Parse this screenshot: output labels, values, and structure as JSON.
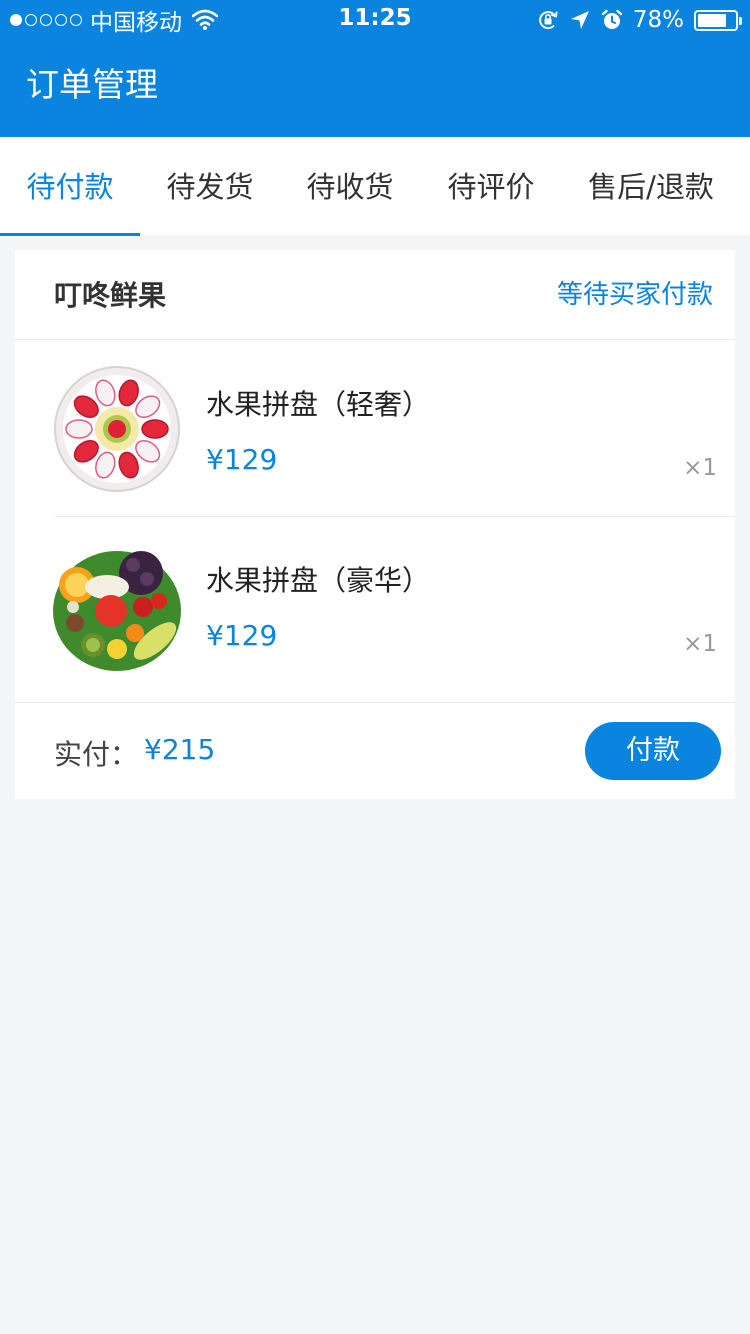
{
  "status_bar": {
    "carrier": "中国移动",
    "time": "11:25",
    "battery": "78%",
    "battery_level": 0.78,
    "icons": [
      "signal-dots",
      "wifi-icon",
      "orientation-lock-icon",
      "location-icon",
      "alarm-icon",
      "battery-icon"
    ]
  },
  "header": {
    "title": "订单管理"
  },
  "tabs": {
    "active_index": 0,
    "items": [
      {
        "label": "待付款"
      },
      {
        "label": "待发货"
      },
      {
        "label": "待收货"
      },
      {
        "label": "待评价"
      },
      {
        "label": "售后/退款"
      }
    ]
  },
  "order": {
    "shop_name": "叮咚鲜果",
    "status": "等待买家付款",
    "items": [
      {
        "name": "水果拼盘（轻奢）",
        "price": "¥129",
        "quantity": "×1",
        "image": "fruit-platter-strawberry"
      },
      {
        "name": "水果拼盘（豪华）",
        "price": "¥129",
        "quantity": "×1",
        "image": "fruit-platter-deluxe"
      }
    ],
    "total_label": "实付：",
    "total_amount": "¥215",
    "pay_button": "付款"
  },
  "colors": {
    "accent": "#0a84df",
    "background": "#f4f5f7",
    "card": "#ffffff",
    "muted": "#999999"
  }
}
